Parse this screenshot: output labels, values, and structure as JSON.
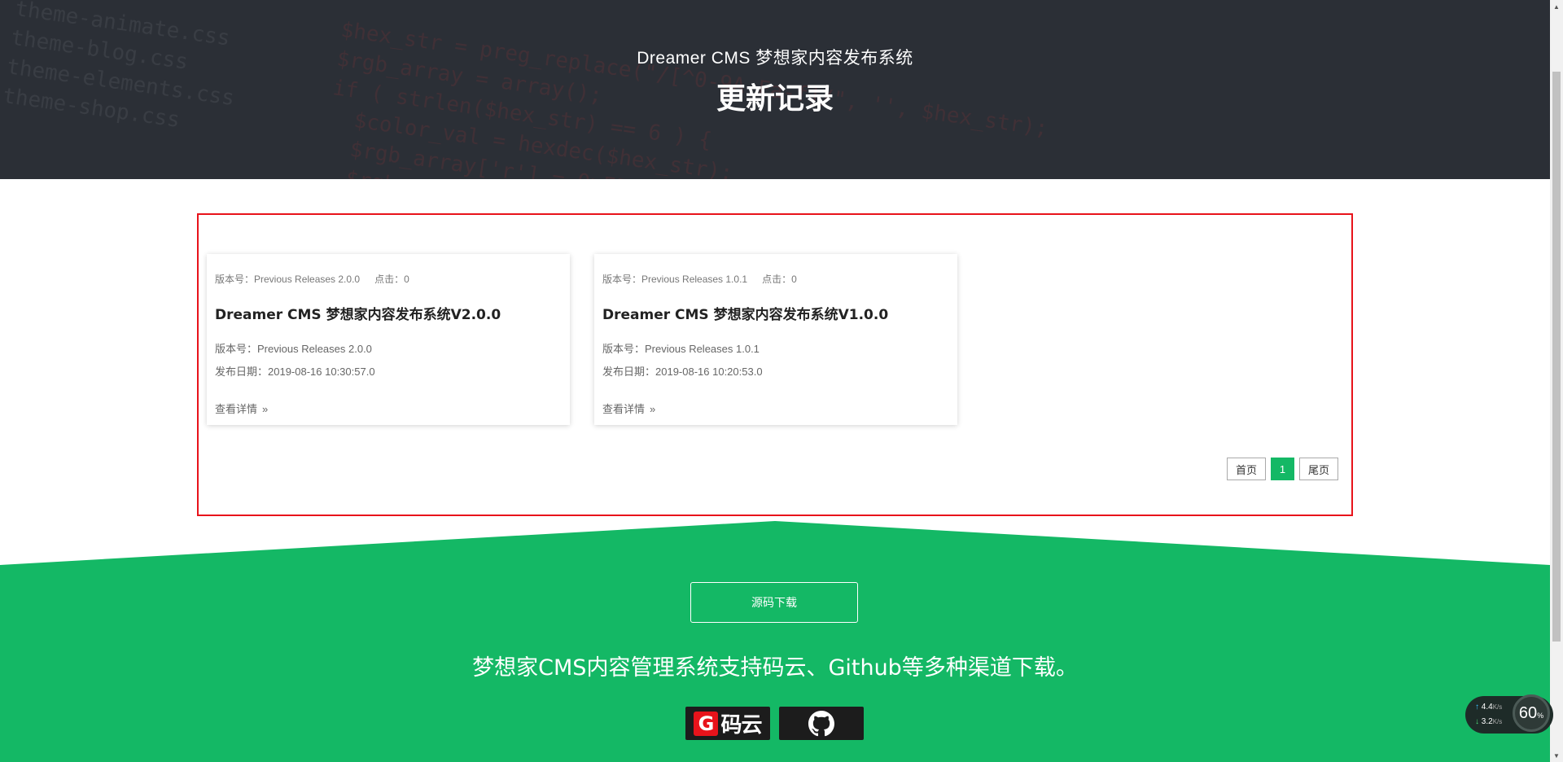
{
  "hero": {
    "site_title": "Dreamer CMS 梦想家内容发布系统",
    "page_heading": "更新记录"
  },
  "releases": [
    {
      "meta_version": "版本号：Previous Releases 2.0.0",
      "meta_clicks": "点击：0",
      "title": "Dreamer CMS 梦想家内容发布系统V2.0.0",
      "version": "版本号：Previous Releases 2.0.0",
      "date": "发布日期：2019-08-16 10:30:57.0",
      "more": "查看详情",
      "more_arrow": "»"
    },
    {
      "meta_version": "版本号：Previous Releases 1.0.1",
      "meta_clicks": "点击：0",
      "title": "Dreamer CMS 梦想家内容发布系统V1.0.0",
      "version": "版本号：Previous Releases 1.0.1",
      "date": "发布日期：2019-08-16 10:20:53.0",
      "more": "查看详情",
      "more_arrow": "»"
    }
  ],
  "pagination": {
    "first": "首页",
    "current": "1",
    "last": "尾页"
  },
  "footer": {
    "download_button": "源码下载",
    "support_text": "梦想家CMS内容管理系统支持码云、Github等多种渠道下载。",
    "gitee_mark": "G",
    "gitee_text": "码云",
    "github_icon": "github-octocat-icon"
  },
  "net_widget": {
    "upload": "4.4",
    "upload_unit": "K/s",
    "download": "3.2",
    "download_unit": "K/s",
    "percent": "60",
    "percent_sign": "%"
  },
  "colors": {
    "hero_bg": "#2b2f36",
    "accent_green": "#14b865",
    "highlight_red": "#e8131b"
  }
}
